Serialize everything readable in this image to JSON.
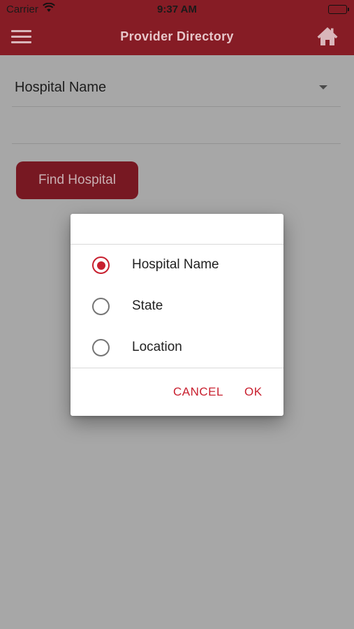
{
  "status_bar": {
    "carrier": "Carrier",
    "time": "9:37 AM"
  },
  "header": {
    "title": "Provider Directory",
    "menu_icon": "hamburger-menu-icon",
    "home_icon": "home-icon",
    "background_color": "#861c25"
  },
  "search": {
    "select_value": "Hospital Name",
    "find_button_label": "Find Hospital"
  },
  "dialog": {
    "options": [
      {
        "label": "Hospital Name",
        "selected": true
      },
      {
        "label": "State",
        "selected": false
      },
      {
        "label": "Location",
        "selected": false
      }
    ],
    "cancel_label": "CANCEL",
    "ok_label": "OK",
    "accent_color": "#c8202f"
  }
}
